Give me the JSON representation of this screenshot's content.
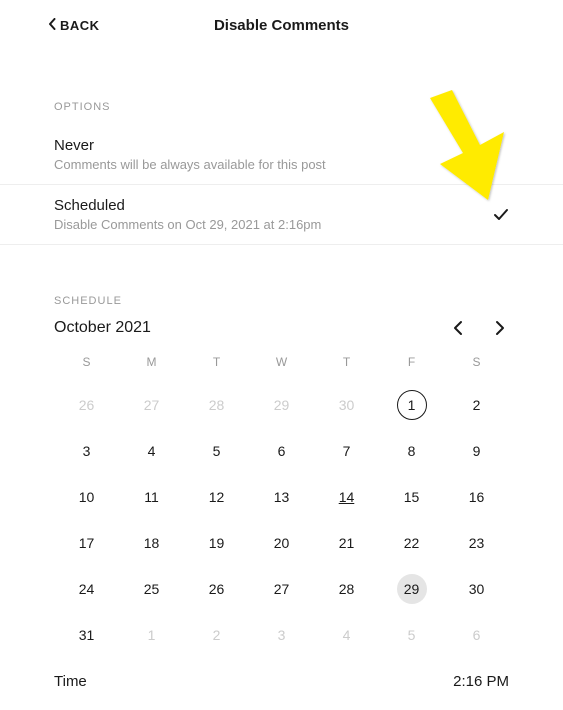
{
  "header": {
    "back_label": "BACK",
    "title": "Disable Comments"
  },
  "options": {
    "section_label": "OPTIONS",
    "items": [
      {
        "title": "Never",
        "subtitle": "Comments will be always available for this post",
        "selected": false
      },
      {
        "title": "Scheduled",
        "subtitle": "Disable Comments on Oct 29, 2021 at 2:16pm",
        "selected": true
      }
    ]
  },
  "schedule": {
    "section_label": "SCHEDULE",
    "month_label": "October 2021",
    "dow": [
      "S",
      "M",
      "T",
      "W",
      "T",
      "F",
      "S"
    ],
    "days": [
      {
        "n": "26",
        "muted": true
      },
      {
        "n": "27",
        "muted": true
      },
      {
        "n": "28",
        "muted": true
      },
      {
        "n": "29",
        "muted": true
      },
      {
        "n": "30",
        "muted": true
      },
      {
        "n": "1",
        "circled": true
      },
      {
        "n": "2"
      },
      {
        "n": "3"
      },
      {
        "n": "4"
      },
      {
        "n": "5"
      },
      {
        "n": "6"
      },
      {
        "n": "7"
      },
      {
        "n": "8"
      },
      {
        "n": "9"
      },
      {
        "n": "10"
      },
      {
        "n": "11"
      },
      {
        "n": "12"
      },
      {
        "n": "13"
      },
      {
        "n": "14",
        "today": true
      },
      {
        "n": "15"
      },
      {
        "n": "16"
      },
      {
        "n": "17"
      },
      {
        "n": "18"
      },
      {
        "n": "19"
      },
      {
        "n": "20"
      },
      {
        "n": "21"
      },
      {
        "n": "22"
      },
      {
        "n": "23"
      },
      {
        "n": "24"
      },
      {
        "n": "25"
      },
      {
        "n": "26"
      },
      {
        "n": "27"
      },
      {
        "n": "28"
      },
      {
        "n": "29",
        "selected": true
      },
      {
        "n": "30"
      },
      {
        "n": "31"
      },
      {
        "n": "1",
        "muted": true
      },
      {
        "n": "2",
        "muted": true
      },
      {
        "n": "3",
        "muted": true
      },
      {
        "n": "4",
        "muted": true
      },
      {
        "n": "5",
        "muted": true
      },
      {
        "n": "6",
        "muted": true
      }
    ]
  },
  "time": {
    "label": "Time",
    "value": "2:16 PM"
  },
  "colors": {
    "annotation_arrow": "#ffeb00"
  }
}
